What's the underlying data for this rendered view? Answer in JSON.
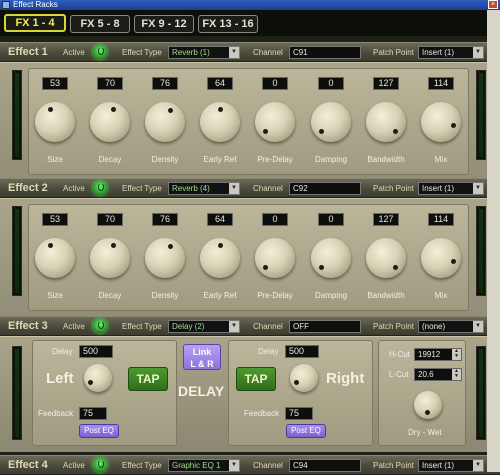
{
  "window": {
    "title": "Effect Racks"
  },
  "tabs": [
    "FX 1 - 4",
    "FX 5 - 8",
    "FX 9 - 12",
    "FX 13 - 16"
  ],
  "header_labels": {
    "active": "Active",
    "effect_type": "Effect Type",
    "channel": "Channel",
    "patch_point": "Patch Point"
  },
  "effects": [
    {
      "name": "Effect 1",
      "effect_type": "Reverb (1)",
      "channel": "C91",
      "patch_point": "Insert (1)",
      "params": [
        {
          "label": "Size",
          "value": "53"
        },
        {
          "label": "Decay",
          "value": "70"
        },
        {
          "label": "Density",
          "value": "76"
        },
        {
          "label": "Early Ref",
          "value": "64"
        },
        {
          "label": "Pre-Delay",
          "value": "0"
        },
        {
          "label": "Damping",
          "value": "0"
        },
        {
          "label": "Bandwidth",
          "value": "127"
        },
        {
          "label": "Mix",
          "value": "114"
        }
      ]
    },
    {
      "name": "Effect 2",
      "effect_type": "Reverb (4)",
      "channel": "C92",
      "patch_point": "Insert (1)",
      "params": [
        {
          "label": "Size",
          "value": "53"
        },
        {
          "label": "Decay",
          "value": "70"
        },
        {
          "label": "Density",
          "value": "76"
        },
        {
          "label": "Early Ref",
          "value": "64"
        },
        {
          "label": "Pre-Delay",
          "value": "0"
        },
        {
          "label": "Damping",
          "value": "0"
        },
        {
          "label": "Bandwidth",
          "value": "127"
        },
        {
          "label": "Mix",
          "value": "114"
        }
      ]
    },
    {
      "name": "Effect 3",
      "effect_type": "Delay (2)",
      "channel": "OFF",
      "patch_point": "(none)"
    },
    {
      "name": "Effect 4",
      "effect_type": "Graphic EQ 1",
      "channel": "C94",
      "patch_point": "Insert (1)"
    }
  ],
  "delay": {
    "delay_label": "Delay",
    "left_delay": "500",
    "right_delay": "500",
    "left_label": "Left",
    "right_label": "Right",
    "tap_label": "TAP",
    "link_label_1": "Link",
    "link_label_2": "L & R",
    "title": "DELAY",
    "feedback_label": "Feedback",
    "left_feedback": "75",
    "right_feedback": "75",
    "post_eq_label": "Post EQ",
    "hcut_label": "H-Cut",
    "hcut_value": "19912",
    "lcut_label": "L-Cut",
    "lcut_value": "20.6",
    "drywet_label": "Dry - Wet"
  }
}
